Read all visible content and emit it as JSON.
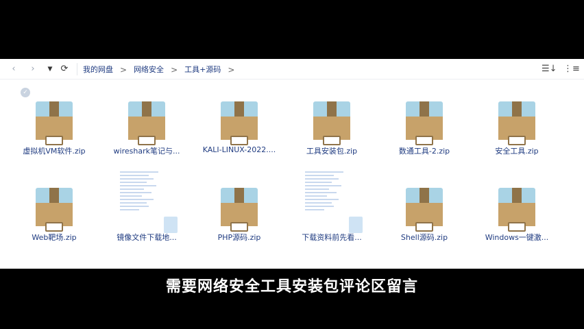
{
  "toolbar": {
    "back_icon": "chevron-left-icon",
    "forward_icon": "chevron-right-icon",
    "dropdown_icon": "caret-down-icon",
    "refresh_icon": "refresh-icon",
    "sort_icon": "sort-icon",
    "list_view_icon": "list-view-icon"
  },
  "breadcrumb": [
    {
      "label": "我的网盘"
    },
    {
      "label": "网络安全"
    },
    {
      "label": "工具+源码"
    }
  ],
  "breadcrumb_sep": ">",
  "files": [
    {
      "name": "虚拟机VM软件.zip",
      "type": "zip",
      "selected": true
    },
    {
      "name": "wireshark笔记与...",
      "type": "zip"
    },
    {
      "name": "KALI-LINUX-2022....",
      "type": "zip"
    },
    {
      "name": "工具安装包.zip",
      "type": "zip"
    },
    {
      "name": "数通工具-2.zip",
      "type": "zip"
    },
    {
      "name": "安全工具.zip",
      "type": "zip"
    },
    {
      "name": "Web靶场.zip",
      "type": "zip"
    },
    {
      "name": "镜像文件下载地...",
      "type": "doc"
    },
    {
      "name": "PHP源码.zip",
      "type": "zip"
    },
    {
      "name": "下载资料前先看...",
      "type": "doc"
    },
    {
      "name": "Shell源码.zip",
      "type": "zip"
    },
    {
      "name": "Windows一键激...",
      "type": "zip"
    }
  ],
  "caption": "需要网络安全工具安装包评论区留言",
  "colors": {
    "box_top": "#a9d3e5",
    "box_body": "#c7a26a",
    "box_strip": "#8f7349",
    "link_text": "#1f3b80"
  }
}
